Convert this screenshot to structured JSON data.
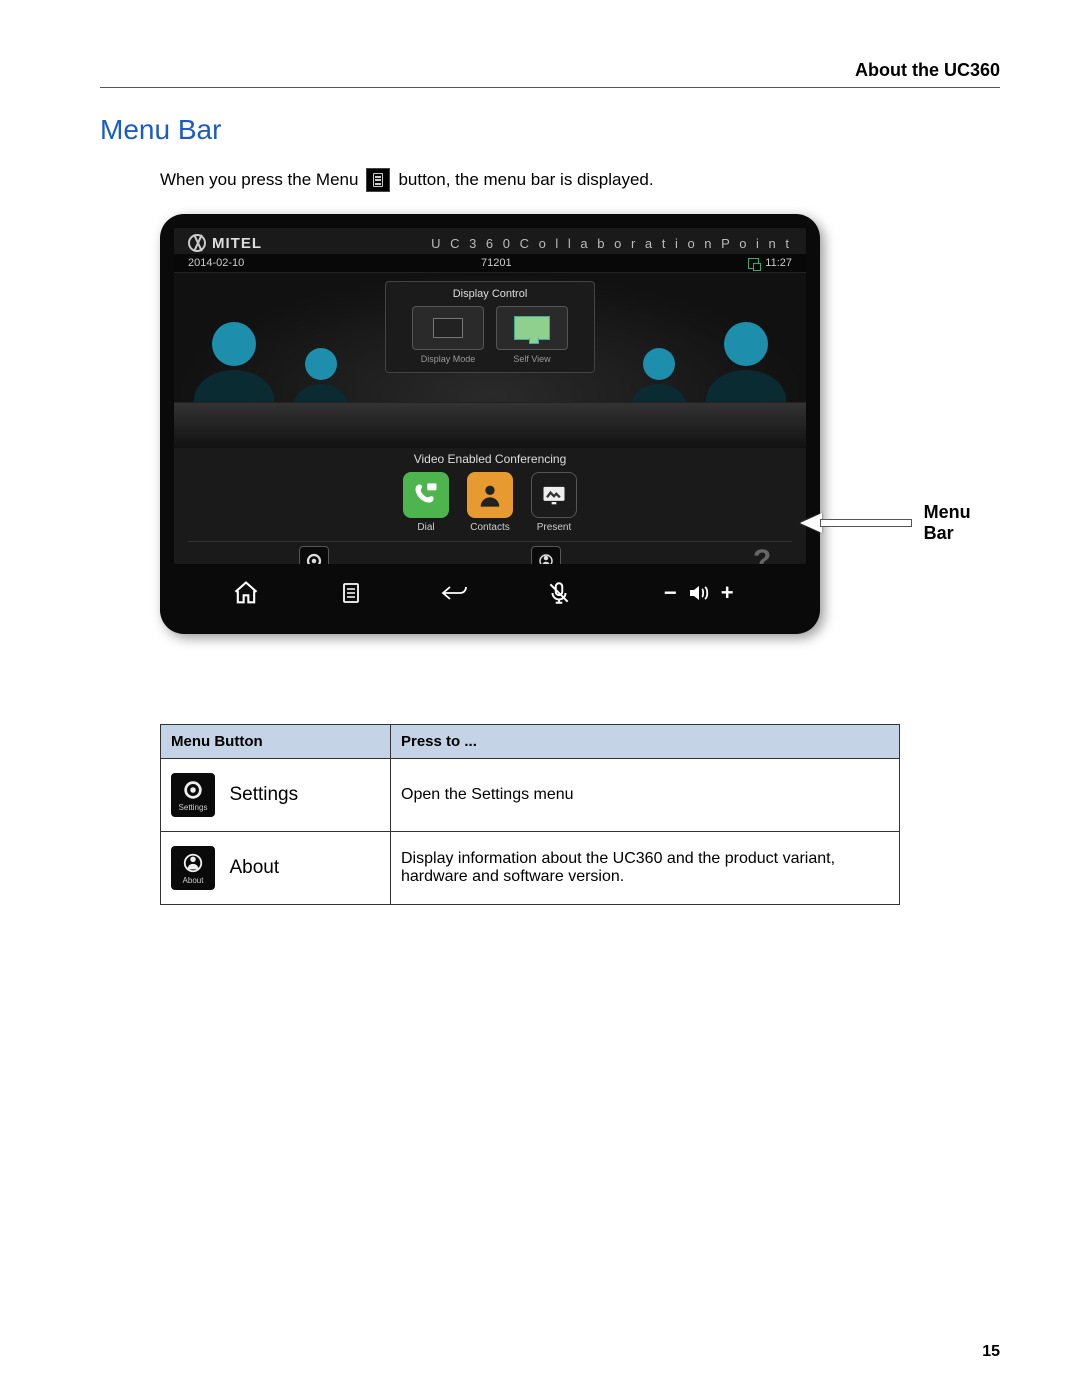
{
  "header": {
    "title": "About the UC360"
  },
  "section_title": "Menu Bar",
  "intro": {
    "part1": "When you press the Menu",
    "part2": "button, the menu bar is displayed."
  },
  "device": {
    "brand": "MITEL",
    "product": "U C 3 6 0   C o l l a b o r a t i o n   P o i n t",
    "status": {
      "date": "2014-02-10",
      "extension": "71201",
      "time": "11:27"
    },
    "panel": {
      "title": "Display Control",
      "buttons": [
        {
          "label": "Display Mode"
        },
        {
          "label": "Self View"
        }
      ]
    },
    "conference_label": "Video Enabled Conferencing",
    "actions": [
      {
        "label": "Dial"
      },
      {
        "label": "Contacts"
      },
      {
        "label": "Present"
      }
    ],
    "menu_items": [
      {
        "label": "Settings"
      },
      {
        "label": "About"
      }
    ]
  },
  "callout_label": "Menu Bar",
  "table": {
    "headers": {
      "col1": "Menu Button",
      "col2": "Press to ..."
    },
    "rows": [
      {
        "icon_sub": "Settings",
        "name": "Settings",
        "desc": "Open the Settings menu"
      },
      {
        "icon_sub": "About",
        "name": "About",
        "desc": "Display information about the UC360 and the product variant, hardware and software version."
      }
    ]
  },
  "page_number": "15"
}
